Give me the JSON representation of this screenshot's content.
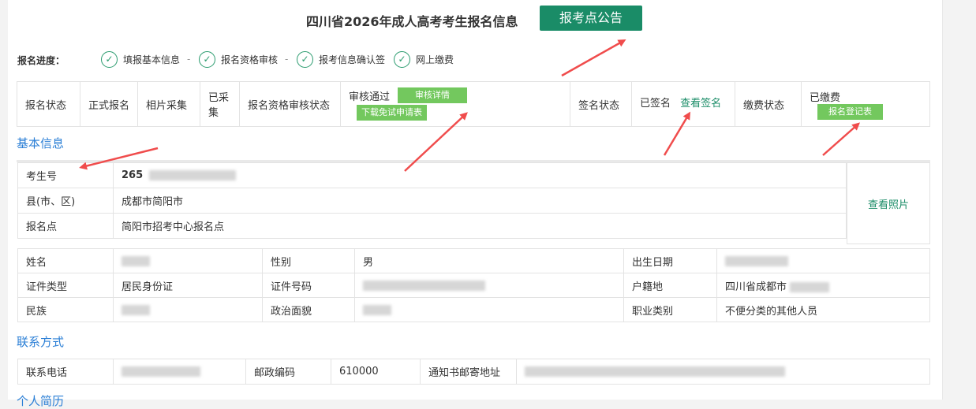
{
  "header": {
    "title": "四川省2026年成人高考考生报名信息",
    "notice_button": "报考点公告"
  },
  "progress": {
    "label": "报名进度：",
    "steps": [
      "填报基本信息",
      "报名资格审核",
      "报考信息确认签",
      "网上缴费"
    ],
    "separator": "-"
  },
  "status": {
    "reg_status_label": "报名状态",
    "reg_status_value": "正式报名",
    "photo_label": "相片采集",
    "photo_value": "已采集",
    "review_label": "报名资格审核状态",
    "review_value": "审核通过",
    "review_detail_button": "审核详情",
    "download_button": "下载免试申请表",
    "sign_label": "签名状态",
    "sign_value": "已签名",
    "sign_link": "查看签名",
    "pay_label": "缴费状态",
    "pay_value": "已缴费",
    "pay_button": "报名登记表"
  },
  "basic": {
    "section_title": "基本信息",
    "exam_no_label": "考生号",
    "exam_no_value": "265",
    "county_label": "县(市、区)",
    "county_value": "成都市简阳市",
    "site_label": "报名点",
    "site_value": "简阳市招考中心报名点",
    "photo_link": "查看照片"
  },
  "info": {
    "name_label": "姓名",
    "gender_label": "性别",
    "gender_value": "男",
    "birth_label": "出生日期",
    "idtype_label": "证件类型",
    "idtype_value": "居民身份证",
    "idno_label": "证件号码",
    "hukou_label": "户籍地",
    "hukou_value": "四川省成都市",
    "nation_label": "民族",
    "politics_label": "政治面貌",
    "job_label": "职业类别",
    "job_value": "不便分类的其他人员"
  },
  "contact": {
    "section_title": "联系方式",
    "phone_label": "联系电话",
    "postcode_label": "邮政编码",
    "postcode_value": "610000",
    "address_label": "通知书邮寄地址"
  },
  "resume": {
    "section_title": "个人简历"
  },
  "colors": {
    "accent": "#1a8c67",
    "button_green": "#73c85e",
    "link_blue": "#2b7fd6",
    "arrow_red": "#f04c4c"
  }
}
